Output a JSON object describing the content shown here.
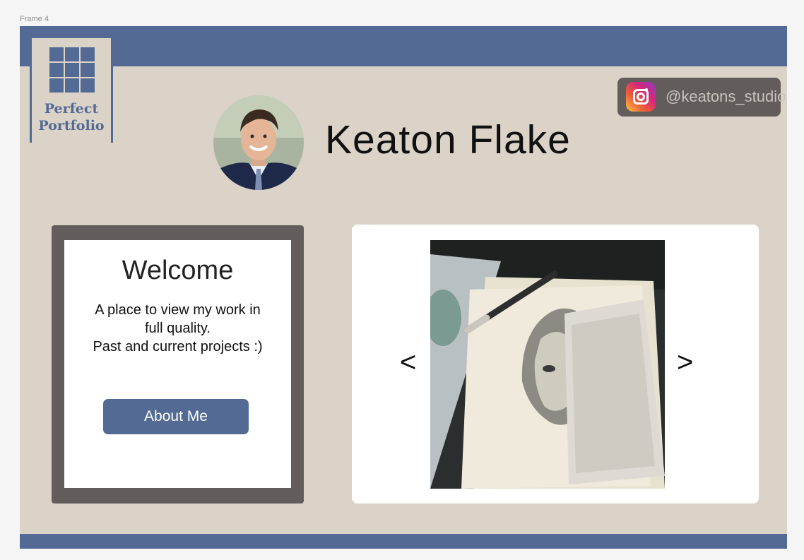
{
  "frame": {
    "label": "Frame 4"
  },
  "logo": {
    "line1": "Perfect",
    "line2": "Portfolio"
  },
  "header": {
    "name": "Keaton Flake"
  },
  "social": {
    "icon": "instagram-icon",
    "handle": "@keatons_studio"
  },
  "welcome": {
    "title": "Welcome",
    "line1": "A place to view my work in",
    "line2": "full quality.",
    "line3": "Past and current projects :)",
    "button_label": "About Me"
  },
  "gallery": {
    "prev": "<",
    "next": ">"
  },
  "colors": {
    "accent": "#536b94",
    "background": "#dbd3c8",
    "dark_panel": "#625c5b",
    "canvas": "#f5f5f5"
  }
}
